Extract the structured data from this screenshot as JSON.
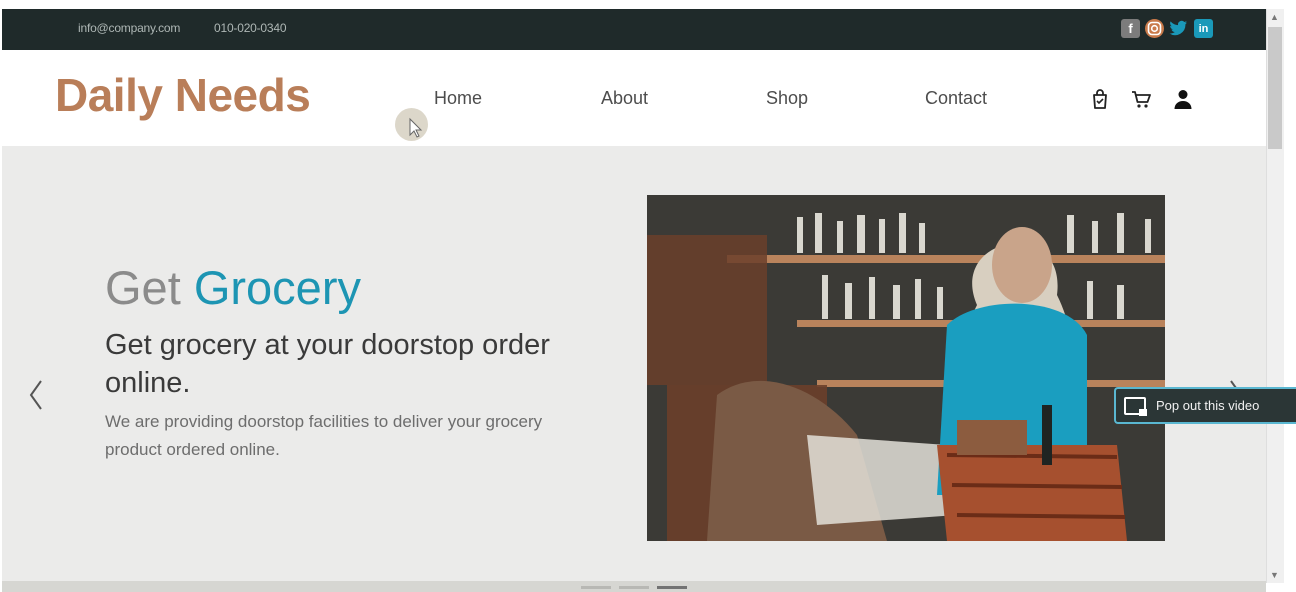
{
  "topbar": {
    "email": "info@company.com",
    "phone": "010-020-0340",
    "social": [
      "facebook-icon",
      "instagram-icon",
      "twitter-icon",
      "linkedin-icon"
    ]
  },
  "header": {
    "brand": "Daily Needs",
    "nav": [
      {
        "label": "Home"
      },
      {
        "label": "About"
      },
      {
        "label": "Shop"
      },
      {
        "label": "Contact"
      }
    ],
    "icons": [
      "shopping-bag-icon",
      "cart-icon",
      "user-icon"
    ]
  },
  "hero": {
    "title_plain": "Get ",
    "title_accent": "Grocery",
    "subtitle": "Get grocery at your doorstop order online.",
    "description": "We are providing doorstop facilities to deliver your grocery product ordered online.",
    "slides_count": 3,
    "active_slide": 3
  },
  "popout": {
    "label": "Pop out this video"
  },
  "colors": {
    "topbar": "#1f2a2a",
    "brand": "#b97e59",
    "accent": "#1d95b3",
    "hero_bg": "#ebebea"
  }
}
